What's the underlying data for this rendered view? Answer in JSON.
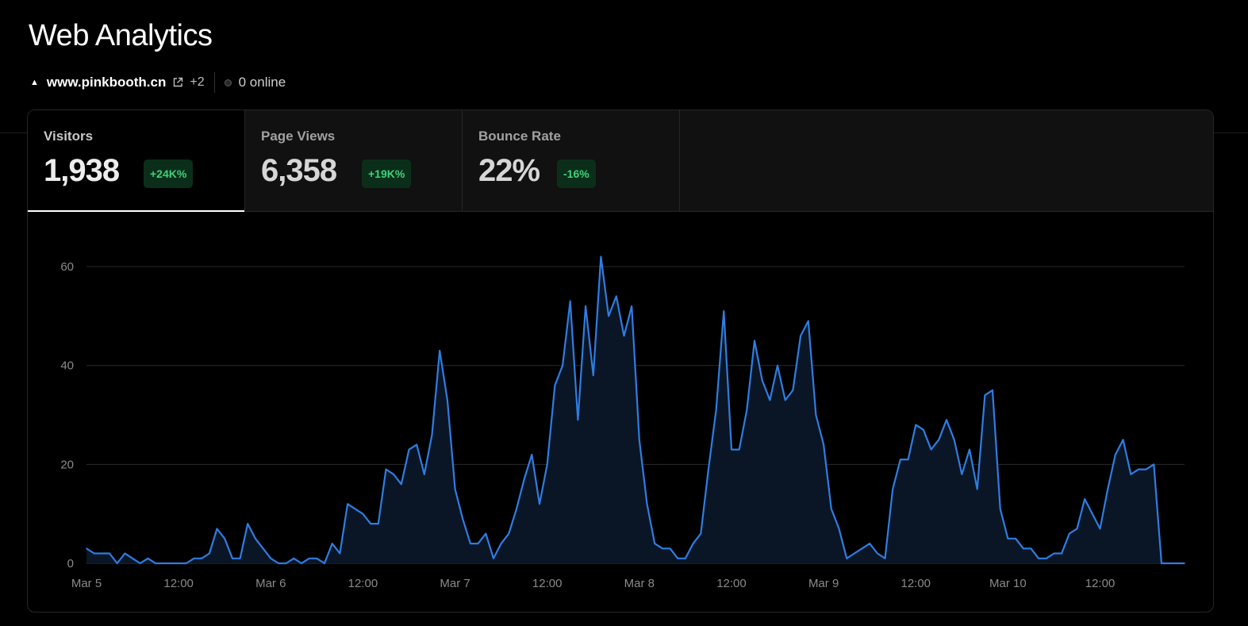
{
  "header": {
    "title": "Web Analytics",
    "domain": "www.pinkbooth.cn",
    "extra_domains": "+2",
    "online": "0 online"
  },
  "tabs": [
    {
      "label": "Visitors",
      "value": "1,938",
      "badge": "+24K%",
      "active": true
    },
    {
      "label": "Page Views",
      "value": "6,358",
      "badge": "+19K%",
      "active": false
    },
    {
      "label": "Bounce Rate",
      "value": "22%",
      "badge": "-16%",
      "active": false
    }
  ],
  "colors": {
    "line": "#2f7de1",
    "area": "#0a1626",
    "badge_bg": "#0b2e1a",
    "badge_text": "#3dd27a"
  },
  "chart_data": {
    "type": "area",
    "series": [
      {
        "values": [
          3,
          2,
          2,
          2,
          0,
          2,
          1,
          0,
          1,
          0,
          0,
          0,
          0,
          0,
          1,
          1,
          2,
          7,
          5,
          1,
          1,
          8,
          5,
          3,
          1,
          0,
          0,
          1,
          0,
          1,
          1,
          0,
          4,
          2,
          12,
          11,
          10,
          8,
          8,
          19,
          18,
          16,
          23,
          24,
          18,
          26,
          43,
          33,
          15,
          9,
          4,
          4,
          6,
          1,
          4,
          6,
          11,
          17,
          22,
          12,
          20,
          36,
          40,
          53,
          29,
          52,
          38,
          62,
          50,
          54,
          46,
          52,
          25,
          12,
          4,
          3,
          3,
          1,
          1,
          4,
          6,
          19,
          31,
          51,
          23,
          23,
          31,
          45,
          37,
          33,
          40,
          33,
          35,
          46,
          49,
          30,
          24,
          11,
          7,
          1,
          2,
          3,
          4,
          2,
          1,
          15,
          21,
          21,
          28,
          27,
          23,
          25,
          29,
          25,
          18,
          23,
          15,
          34,
          35,
          11,
          5,
          5,
          3,
          3,
          1,
          1,
          2,
          2,
          6,
          7,
          13,
          10,
          7,
          15,
          22,
          25,
          18,
          19,
          19,
          20,
          0,
          0,
          0,
          0
        ]
      }
    ],
    "x_tick_labels": [
      "Mar 5",
      "12:00",
      "Mar 6",
      "12:00",
      "Mar 7",
      "12:00",
      "Mar 8",
      "12:00",
      "Mar 9",
      "12:00",
      "Mar 10",
      "12:00"
    ],
    "y_ticks": [
      0,
      20,
      40,
      60
    ],
    "ylim": [
      0,
      65
    ],
    "grid": true
  }
}
